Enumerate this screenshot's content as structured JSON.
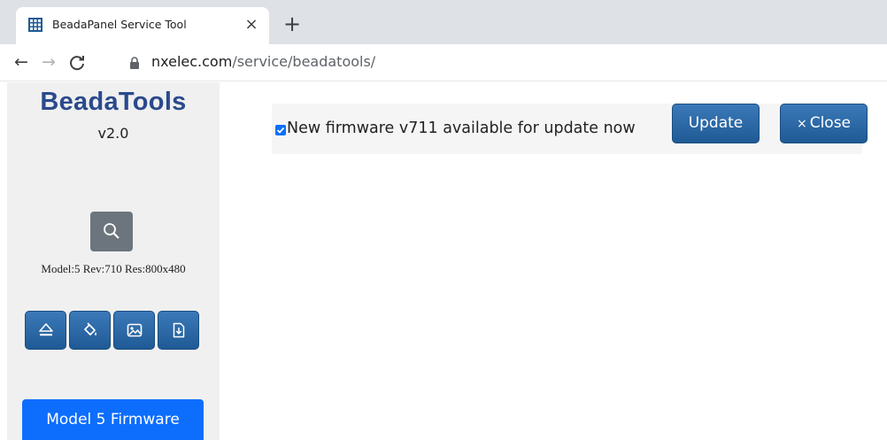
{
  "browser": {
    "tab": {
      "title": "BeadaPanel Service Tool",
      "favicon": "grid-favicon-icon",
      "close_glyph": "×"
    },
    "new_tab_glyph": "+",
    "nav": {
      "back_glyph": "←",
      "forward_glyph": "→",
      "reload_glyph": "C"
    },
    "address": {
      "host": "nxelec.com",
      "path": "/service/beadatools/"
    }
  },
  "sidebar": {
    "app_name": "BeadaTools",
    "version": "v2.0",
    "model_info": "Model:5 Rev:710 Res:800x480",
    "tools": [
      {
        "icon": "eject-icon"
      },
      {
        "icon": "paint-bucket-icon"
      },
      {
        "icon": "image-icon"
      },
      {
        "icon": "file-download-icon"
      }
    ],
    "firmware_button": "Model 5 Firmware"
  },
  "notice": {
    "checked": true,
    "text": "New firmware v711 available for update now",
    "update_label": "Update",
    "close_glyph": "×",
    "close_label": "Close"
  },
  "colors": {
    "title": "#2b4a8c",
    "button": "#2867a6",
    "primary": "#0d6efd",
    "secondary": "#6c757d",
    "sidebar_bg": "#f0f0f0"
  }
}
